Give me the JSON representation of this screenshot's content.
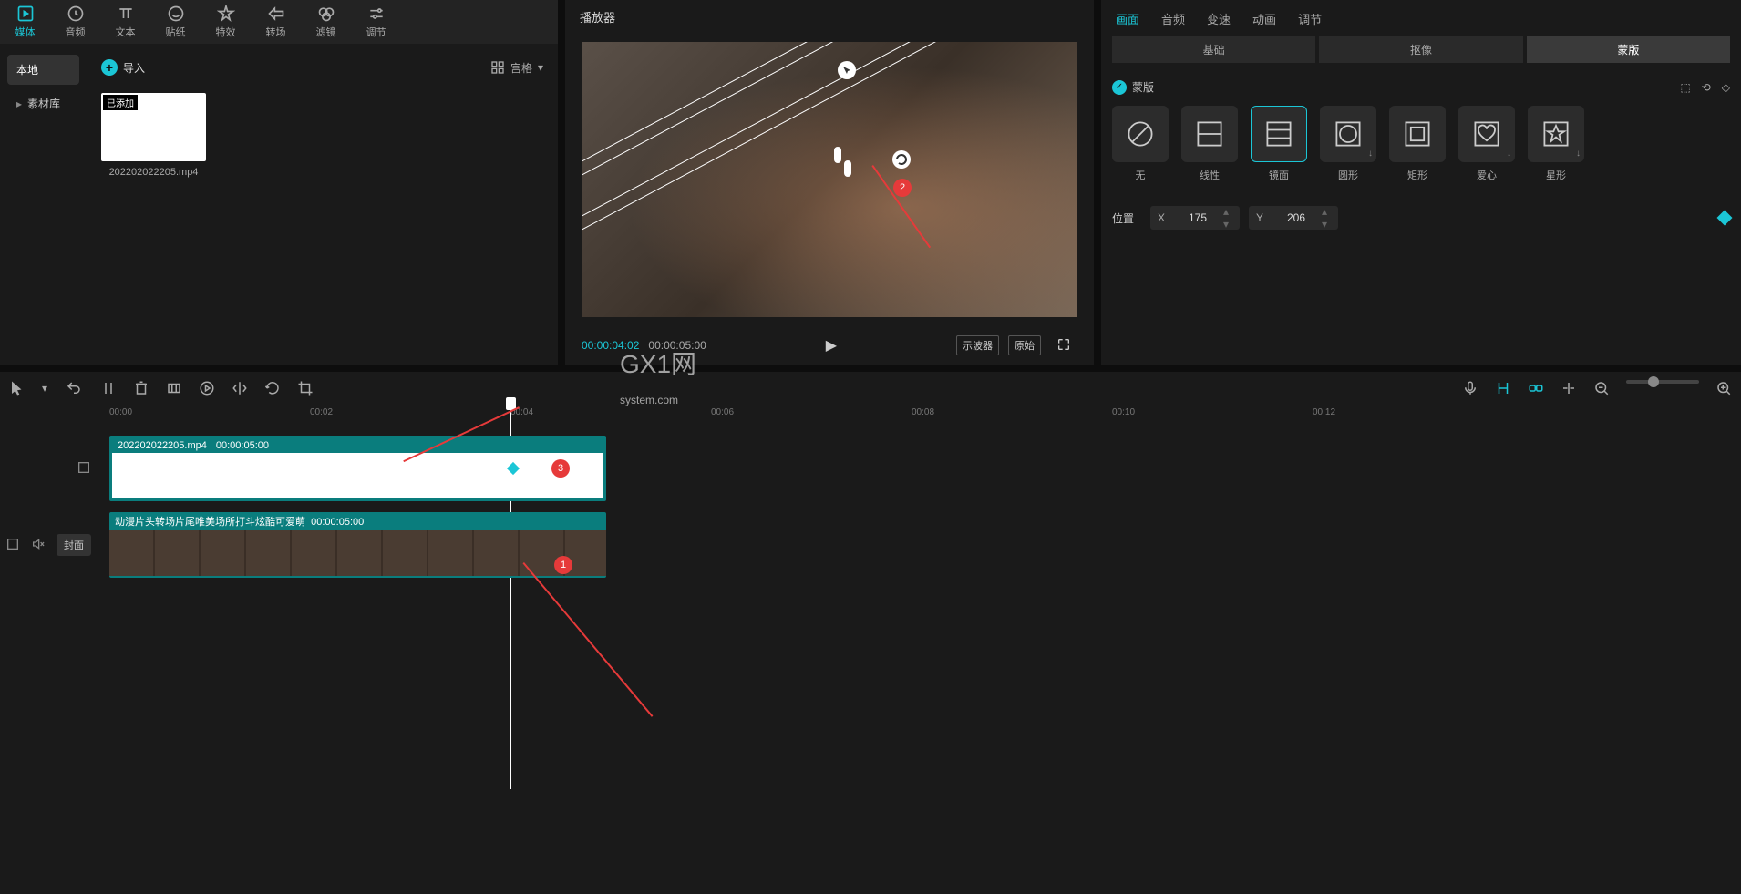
{
  "top_tabs": [
    {
      "label": "媒体",
      "active": true
    },
    {
      "label": "音频"
    },
    {
      "label": "文本"
    },
    {
      "label": "贴纸"
    },
    {
      "label": "特效"
    },
    {
      "label": "转场"
    },
    {
      "label": "滤镜"
    },
    {
      "label": "调节"
    }
  ],
  "sidebar": {
    "items": [
      {
        "label": "本地",
        "active": true
      },
      {
        "label": "素材库"
      }
    ]
  },
  "import_label": "导入",
  "view_label": "宫格",
  "media": {
    "added_badge": "已添加",
    "filename": "202202022205.mp4"
  },
  "player": {
    "title": "播放器",
    "current_time": "00:00:04:02",
    "total_time": "00:00:05:00",
    "oscilloscope": "示波器",
    "original": "原始"
  },
  "right": {
    "tabs": [
      "画面",
      "音频",
      "变速",
      "动画",
      "调节"
    ],
    "active_tab": 0,
    "subtabs": [
      "基础",
      "抠像",
      "蒙版"
    ],
    "active_subtab": 2,
    "mask_title": "蒙版",
    "masks": [
      {
        "label": "无"
      },
      {
        "label": "线性"
      },
      {
        "label": "镜面",
        "active": true
      },
      {
        "label": "圆形",
        "dl": true
      },
      {
        "label": "矩形"
      },
      {
        "label": "爱心",
        "dl": true
      },
      {
        "label": "星形",
        "dl": true
      }
    ],
    "position_label": "位置",
    "x_label": "X",
    "x_value": "175",
    "y_label": "Y",
    "y_value": "206"
  },
  "timeline": {
    "ticks": [
      "00:00",
      "00:02",
      "00:04",
      "00:06",
      "00:08",
      "00:10",
      "00:12"
    ],
    "cover_btn": "封面",
    "clip1_name": "202202022205.mp4",
    "clip1_dur": "00:00:05:00",
    "clip2_name": "动漫片头转场片尾唯美场所打斗炫酷可爱萌",
    "clip2_dur": "00:00:05:00"
  },
  "annotations": {
    "a1": "1",
    "a2": "2",
    "a3": "3"
  },
  "watermark": {
    "big": "GX1网",
    "small": "system.com"
  }
}
